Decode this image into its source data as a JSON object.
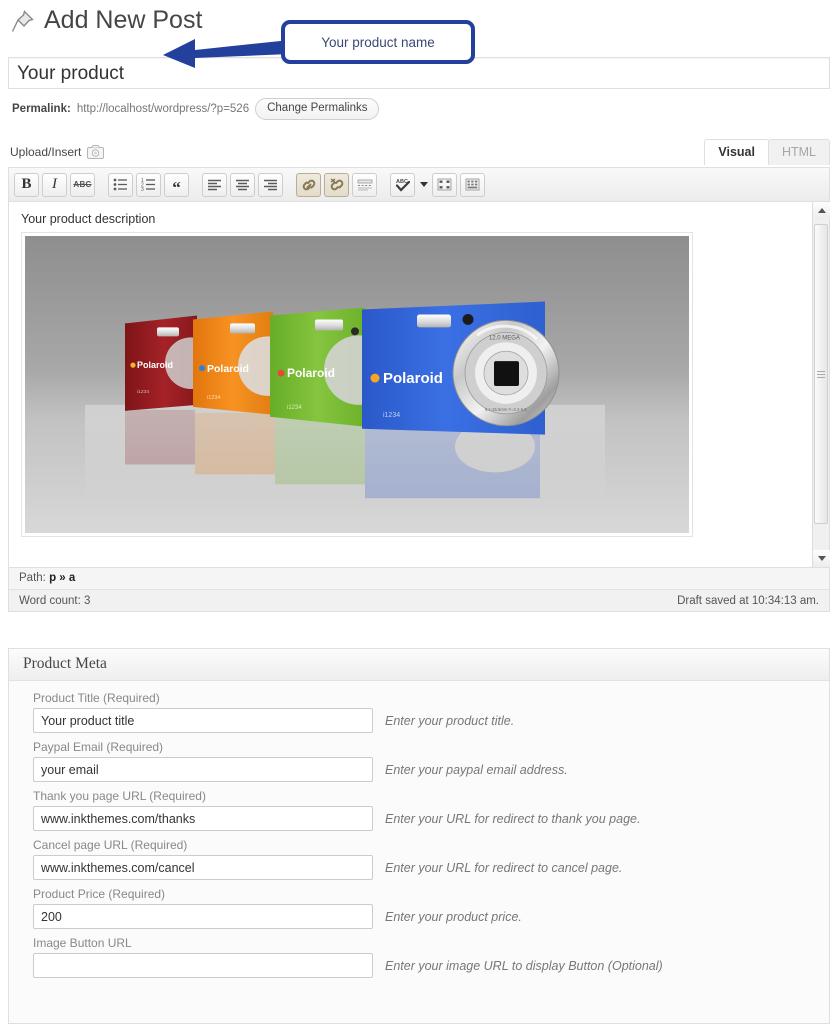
{
  "header": {
    "title": "Add New Post",
    "pin_icon": "pushpin-icon"
  },
  "post_title": {
    "value": "Your product"
  },
  "permalink": {
    "label": "Permalink:",
    "url": "http://localhost/wordpress/?p=526",
    "button_label": "Change Permalinks"
  },
  "media": {
    "upload_label": "Upload/Insert",
    "icon": "media-camera-icon"
  },
  "editor": {
    "tabs": [
      {
        "label": "Visual",
        "active": true
      },
      {
        "label": "HTML",
        "active": false
      }
    ],
    "toolbar": [
      {
        "name": "bold",
        "glyph": "B"
      },
      {
        "name": "italic",
        "glyph": "I"
      },
      {
        "name": "strikethrough",
        "glyph": "ABC"
      },
      {
        "name": "unordered-list",
        "glyph": ""
      },
      {
        "name": "ordered-list",
        "glyph": ""
      },
      {
        "name": "blockquote",
        "glyph": "““"
      },
      {
        "name": "align-left",
        "glyph": ""
      },
      {
        "name": "align-center",
        "glyph": ""
      },
      {
        "name": "align-right",
        "glyph": ""
      },
      {
        "name": "insert-link",
        "glyph": ""
      },
      {
        "name": "unlink",
        "glyph": ""
      },
      {
        "name": "insert-more-tag",
        "glyph": ""
      },
      {
        "name": "spellcheck",
        "glyph": "ABC"
      },
      {
        "name": "fullscreen",
        "glyph": ""
      },
      {
        "name": "kitchen-sink",
        "glyph": ""
      }
    ],
    "content": {
      "description": "Your product description",
      "image_alt": "Four Polaroid digital cameras in red, orange, green and blue"
    },
    "path_label": "Path:",
    "path_value": "p » a",
    "word_count": "Word count: 3",
    "draft_status": "Draft saved at 10:34:13 am."
  },
  "meta_box": {
    "title": "Product Meta",
    "fields": [
      {
        "label": "Product Title (Required)",
        "value": "Your product title",
        "hint": "Enter your product title."
      },
      {
        "label": "Paypal Email (Required)",
        "value": "your email",
        "hint": "Enter your paypal email address."
      },
      {
        "label": "Thank you page URL (Required)",
        "value": "www.inkthemes.com/thanks",
        "hint": "Enter your URL for redirect to thank you page."
      },
      {
        "label": "Cancel page URL (Required)",
        "value": "www.inkthemes.com/cancel",
        "hint": "Enter your URL for redirect to cancel page."
      },
      {
        "label": "Product Price (Required)",
        "value": "200",
        "hint": "Enter your product price."
      },
      {
        "label": "Image Button URL",
        "value": "",
        "hint": "Enter your image URL to display Button (Optional)"
      }
    ]
  },
  "annotation": {
    "text": "Your product name",
    "border_color": "#23409c",
    "arrow_color": "#23409c"
  },
  "product_image": {
    "brand": "Polaroid",
    "model": "i1234",
    "lens_text": "12.0 MEGA",
    "cameras": [
      {
        "color_name": "red",
        "hex": "#9d1d20"
      },
      {
        "color_name": "orange",
        "hex": "#f08215"
      },
      {
        "color_name": "green",
        "hex": "#79bb34"
      },
      {
        "color_name": "blue",
        "hex": "#2f63d8"
      }
    ]
  }
}
